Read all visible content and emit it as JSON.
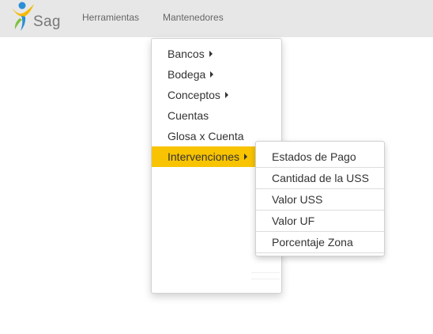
{
  "brand": {
    "name": "Sag"
  },
  "navbar": {
    "items": [
      {
        "label": "Herramientas"
      },
      {
        "label": "Mantenedores"
      }
    ]
  },
  "dropdown": {
    "items": [
      {
        "label": "Bancos",
        "has_submenu": true
      },
      {
        "label": "Bodega",
        "has_submenu": true
      },
      {
        "label": "Conceptos",
        "has_submenu": true
      },
      {
        "label": "Cuentas",
        "has_submenu": false
      },
      {
        "label": "Glosa x Cuenta",
        "has_submenu": false
      },
      {
        "label": "Intervenciones",
        "has_submenu": true,
        "active": true
      }
    ]
  },
  "submenu": {
    "items": [
      {
        "label": "Estados de Pago"
      },
      {
        "label": "Cantidad de la USS"
      },
      {
        "label": "Valor USS"
      },
      {
        "label": "Valor UF"
      },
      {
        "label": "Porcentaje Zona"
      }
    ]
  },
  "colors": {
    "navbar_bg": "#e7e7e7",
    "active_item_bg": "#f8c300",
    "logo_yellow": "#f5b800",
    "logo_blue": "#2b8fd6",
    "logo_green": "#7cc242"
  }
}
